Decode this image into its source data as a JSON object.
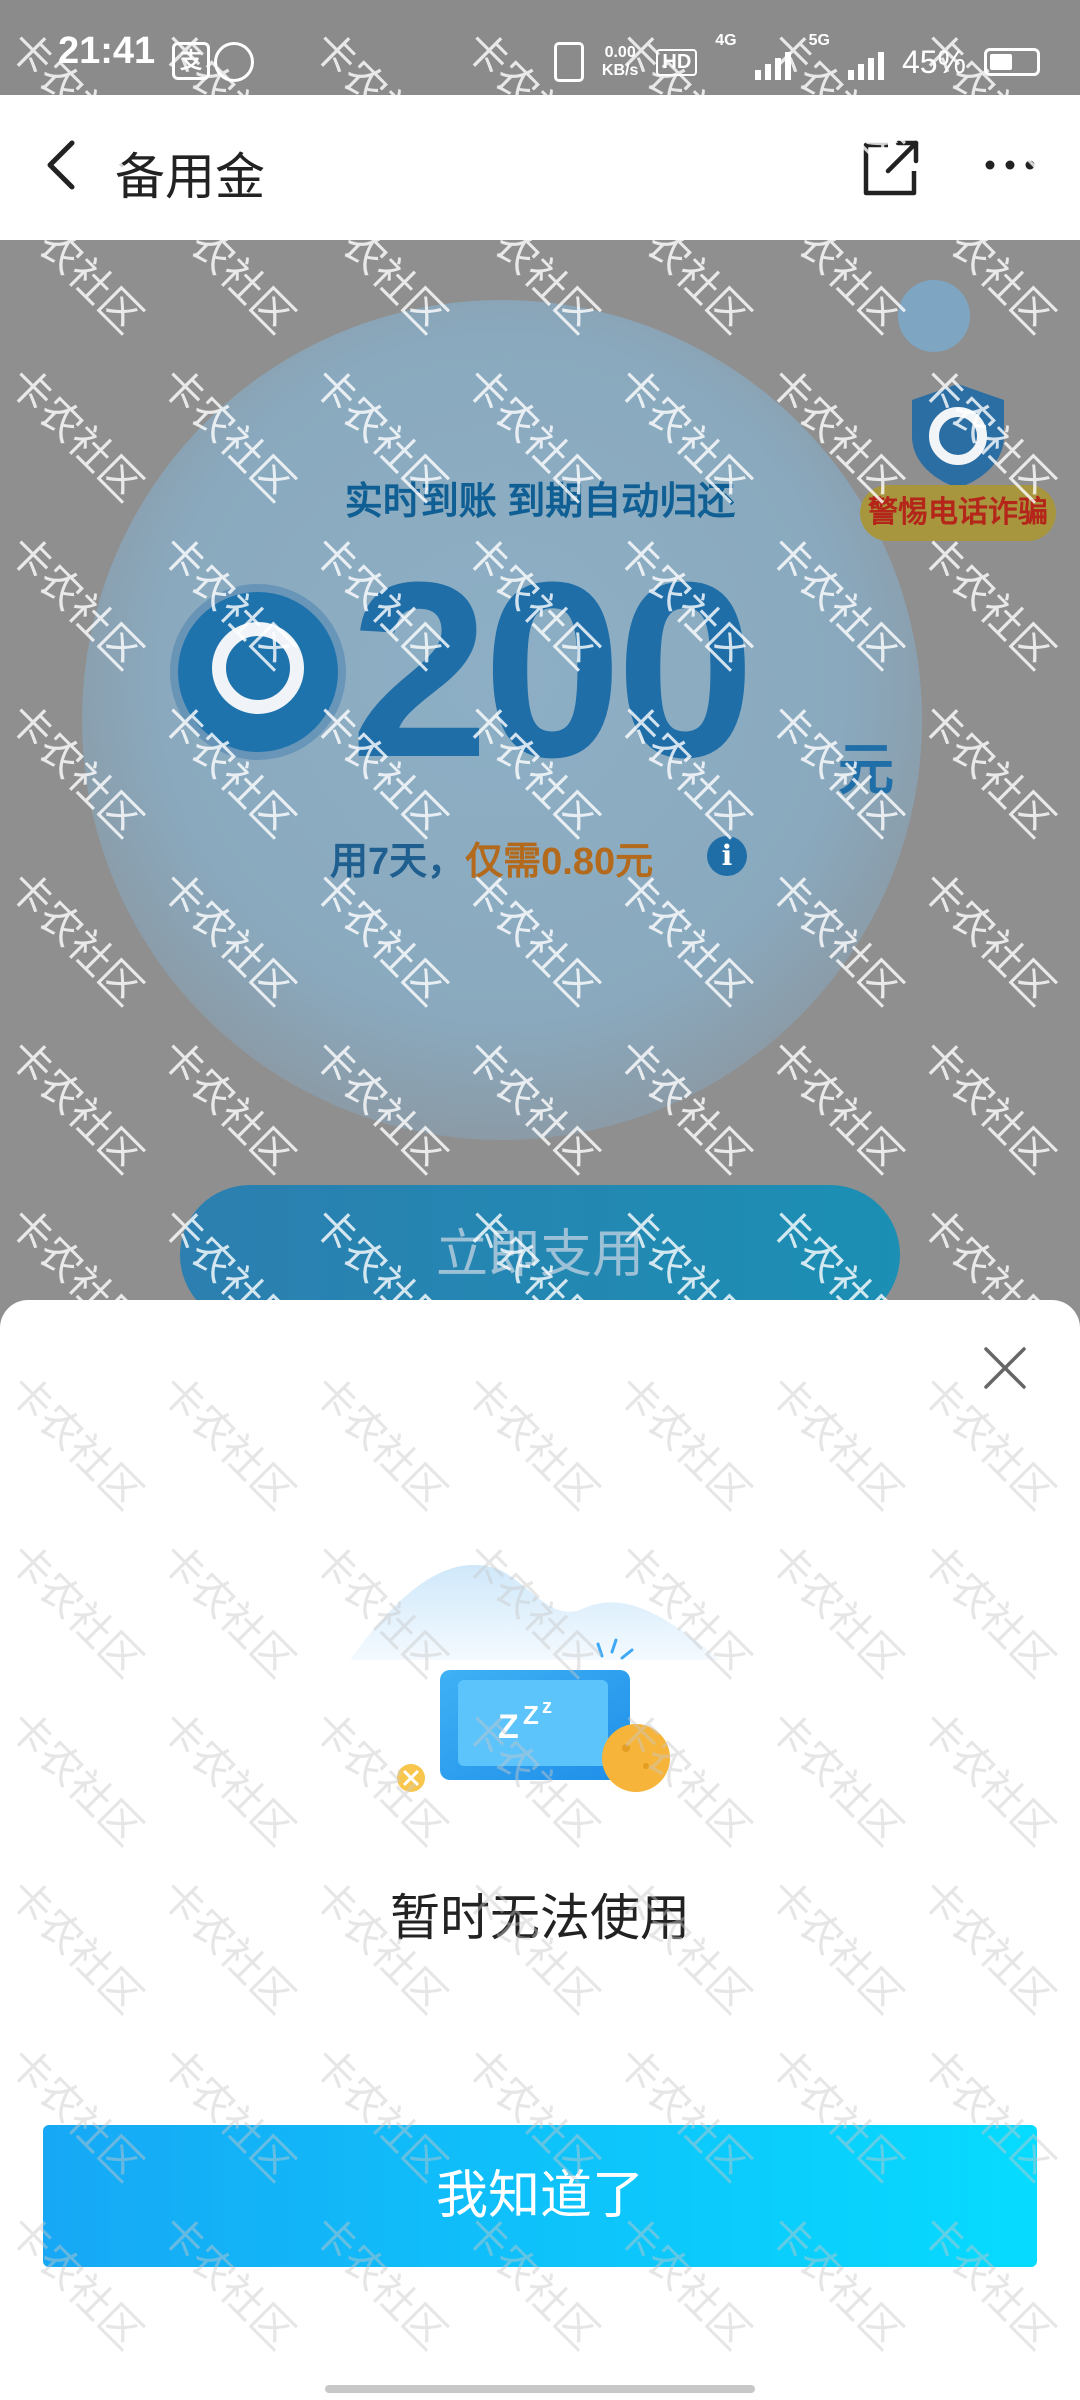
{
  "status_bar": {
    "time": "21:41",
    "pay_icon_text": "支",
    "net_speed": "0.00",
    "net_speed_unit": "KB/s",
    "hd": "HD",
    "network_1": "4G",
    "network_2": "5G",
    "battery": "45%"
  },
  "nav": {
    "title": "备用金"
  },
  "main": {
    "subtitle": "实时到账 到期自动归还",
    "amount": "200",
    "amount_unit": "元",
    "fee_prefix": "用7天，",
    "fee_highlight": "仅需0.80元",
    "info_icon_text": "i",
    "fraud_badge": "警惕电话诈骗",
    "use_button": "立即支用"
  },
  "dialog": {
    "message": "暂时无法使用",
    "confirm_button": "我知道了"
  },
  "watermark": {
    "text": "卡农社区"
  },
  "colors": {
    "accent_blue": "#1f6ea8",
    "confirm_gradient_start": "#17a8f5",
    "confirm_gradient_end": "#06dbff",
    "fee_highlight": "#b36a1c",
    "fraud_text": "#b5261a"
  }
}
